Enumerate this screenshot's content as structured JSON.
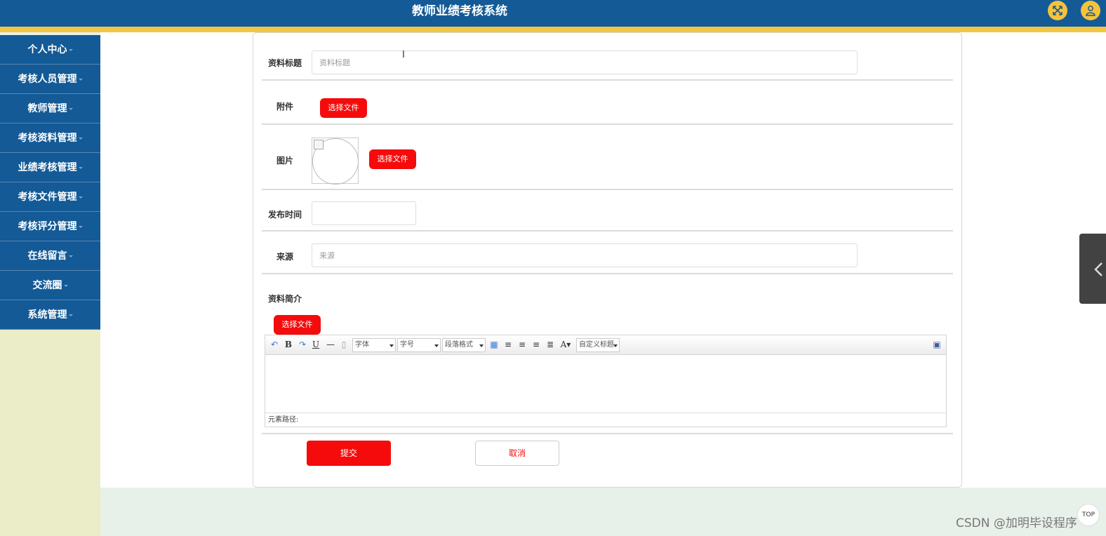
{
  "header": {
    "title": "教师业绩考核系统"
  },
  "sidebar": {
    "items": [
      {
        "label": "个人中心"
      },
      {
        "label": "考核人员管理"
      },
      {
        "label": "教师管理"
      },
      {
        "label": "考核资料管理"
      },
      {
        "label": "业绩考核管理"
      },
      {
        "label": "考核文件管理"
      },
      {
        "label": "考核评分管理"
      },
      {
        "label": "在线留言"
      },
      {
        "label": "交流圈"
      },
      {
        "label": "系统管理"
      }
    ]
  },
  "form": {
    "title": {
      "label": "资料标题",
      "placeholder": "资料标题",
      "value": ""
    },
    "attachment": {
      "label": "附件",
      "button": "选择文件"
    },
    "image": {
      "label": "图片",
      "button": "选择文件"
    },
    "publish_time": {
      "label": "发布时间",
      "value": ""
    },
    "source": {
      "label": "来源",
      "placeholder": "来源",
      "value": ""
    },
    "intro": {
      "label": "资料简介",
      "button": "选择文件"
    },
    "editor": {
      "font_family": "字体",
      "font_size": "字号",
      "paragraph": "段落格式",
      "custom_title": "自定义标题",
      "status": "元素路径:"
    },
    "submit": "提交",
    "cancel": "取消"
  },
  "watermark": "CSDN @加明毕设程序",
  "top_button": "TOP",
  "colors": {
    "primary": "#135a96",
    "accent": "#f2c641",
    "danger": "#f50b0b"
  }
}
